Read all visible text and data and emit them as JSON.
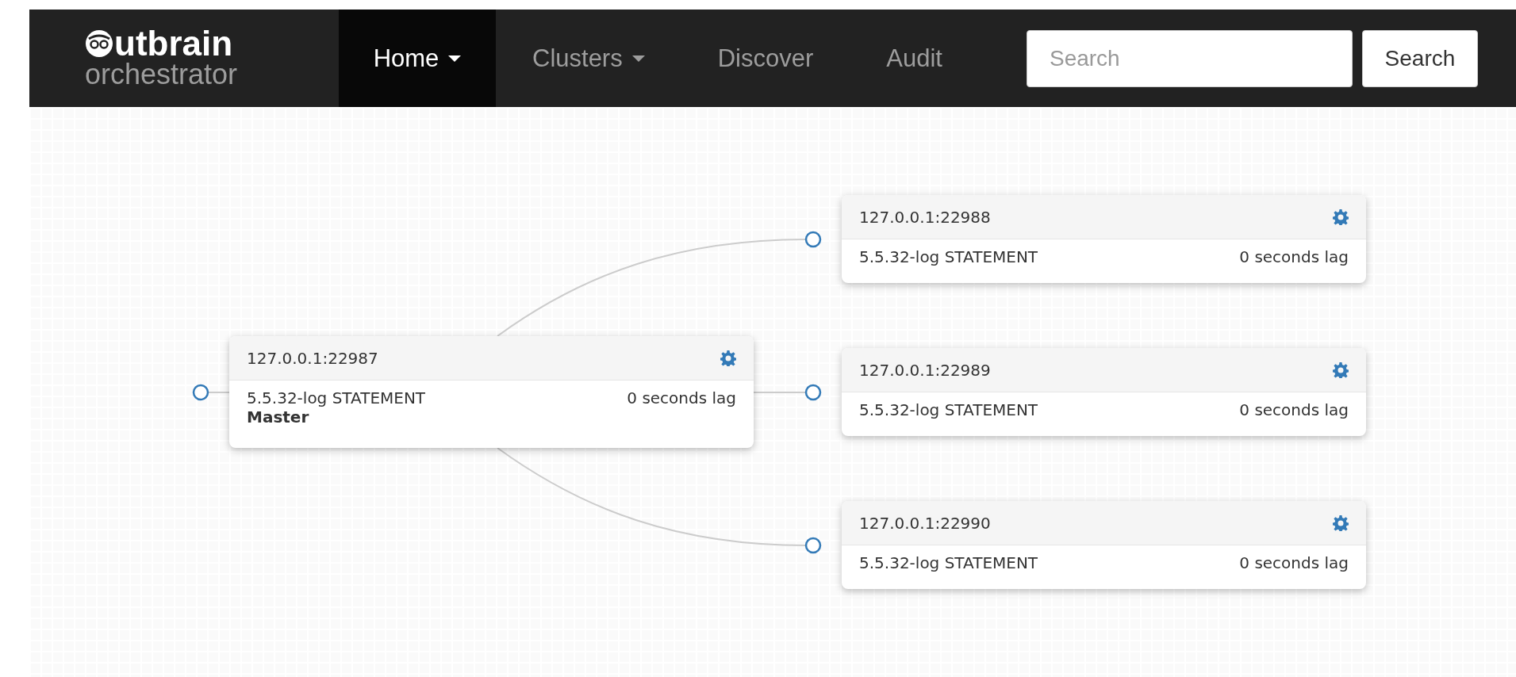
{
  "brand": {
    "wordmark": "utbrain",
    "subtitle": "orchestrator"
  },
  "nav": [
    {
      "label": "Home",
      "dropdown": true,
      "selected": true
    },
    {
      "label": "Clusters",
      "dropdown": true,
      "selected": false
    },
    {
      "label": "Discover",
      "dropdown": false,
      "selected": false
    },
    {
      "label": "Audit",
      "dropdown": false,
      "selected": false
    }
  ],
  "search": {
    "placeholder": "Search",
    "button": "Search"
  },
  "master": {
    "address": "127.0.0.1:22987",
    "version": "5.5.32-log STATEMENT",
    "lag": "0 seconds lag",
    "role": "Master"
  },
  "replicas": [
    {
      "address": "127.0.0.1:22988",
      "version": "5.5.32-log STATEMENT",
      "lag": "0 seconds lag"
    },
    {
      "address": "127.0.0.1:22989",
      "version": "5.5.32-log STATEMENT",
      "lag": "0 seconds lag"
    },
    {
      "address": "127.0.0.1:22990",
      "version": "5.5.32-log STATEMENT",
      "lag": "0 seconds lag"
    }
  ]
}
